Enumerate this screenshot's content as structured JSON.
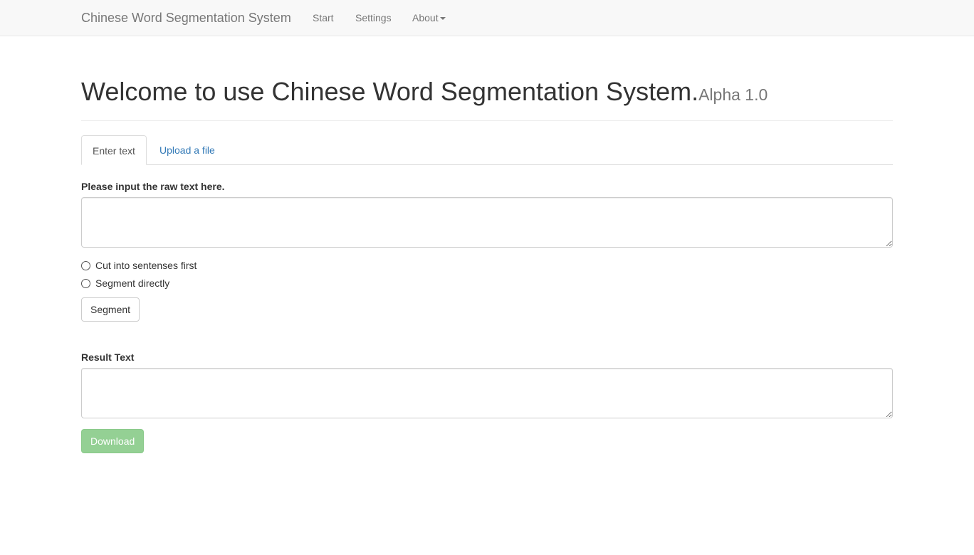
{
  "navbar": {
    "brand": "Chinese Word Segmentation System",
    "links": [
      "Start",
      "Settings",
      "About"
    ]
  },
  "header": {
    "title": "Welcome to use Chinese Word Segmentation System.",
    "version": "Alpha 1.0"
  },
  "tabs": [
    {
      "label": "Enter text",
      "active": true
    },
    {
      "label": "Upload a file",
      "active": false
    }
  ],
  "input": {
    "label": "Please input the raw text here.",
    "value": ""
  },
  "options": {
    "radios": [
      {
        "label": "Cut into sentenses first",
        "checked": false
      },
      {
        "label": "Segment directly",
        "checked": false
      }
    ]
  },
  "actions": {
    "segment_label": "Segment",
    "download_label": "Download"
  },
  "result": {
    "label": "Result Text",
    "value": ""
  },
  "colors": {
    "link": "#337ab7",
    "success": "#5cb85c",
    "navbar_bg": "#f8f8f8"
  }
}
